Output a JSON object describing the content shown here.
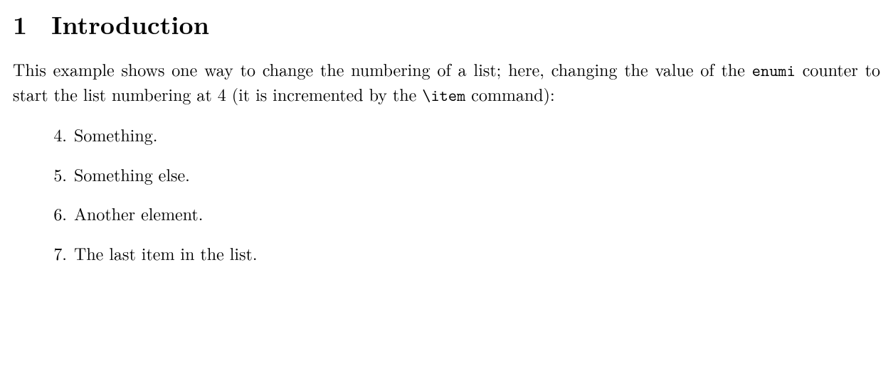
{
  "section": {
    "number": "1",
    "title": "Introduction"
  },
  "paragraph": {
    "segments": [
      {
        "text": "This example shows one way to change the numbering of a list; here, changing the value of the "
      },
      {
        "text": "enumi",
        "tt": true
      },
      {
        "text": " counter to start the list numbering at 4 (it is incremented by the "
      },
      {
        "text": "\\item",
        "tt": true
      },
      {
        "text": " command):"
      }
    ]
  },
  "list": {
    "items": [
      {
        "number": "4.",
        "text": "Something."
      },
      {
        "number": "5.",
        "text": "Something else."
      },
      {
        "number": "6.",
        "text": "Another element."
      },
      {
        "number": "7.",
        "text": "The last item in the list."
      }
    ]
  }
}
